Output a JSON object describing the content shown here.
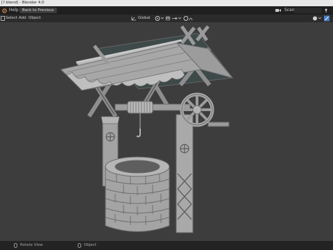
{
  "window": {
    "title": "[?.blend] - Blender 4.0"
  },
  "topbar": {
    "menu_help": "Help",
    "back_button": "Back to Previous",
    "scene_label": "Scene"
  },
  "header": {
    "menu_select": "Select",
    "menu_add": "Add",
    "menu_object": "Object",
    "transform_orientation": "Global"
  },
  "statusbar": {
    "rotate_view": "Rotate View",
    "object": "Object"
  },
  "icons": [
    "blender-logo-icon",
    "scene-icon",
    "pin-icon",
    "transform-pivot-icon",
    "snap-icon",
    "proportional-edit-icon",
    "viewport-shading-icon",
    "mouse-icon"
  ],
  "colors": {
    "viewport_bg": "#3d3d3d",
    "model_gray": "#a9a9a9",
    "topbar_bg": "#1f1f1f",
    "header_bg": "#2b2b2b",
    "accent_blue": "#4a7fc1"
  }
}
